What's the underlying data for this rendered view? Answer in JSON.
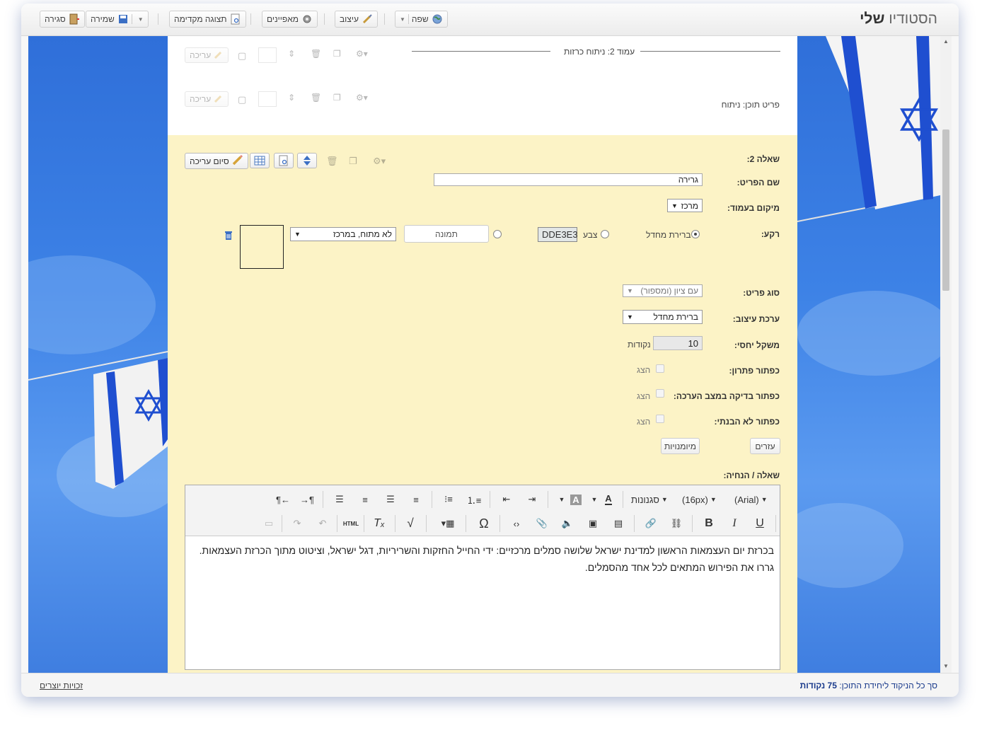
{
  "app": {
    "logo_main": "הסטודיו",
    "logo_bold": "שלי"
  },
  "toolbar": {
    "language": "שפה",
    "design": "עיצוב",
    "properties": "מאפיינים",
    "preview": "תצוגה מקדימה",
    "save": "שמירה",
    "close": "סגירה"
  },
  "page_header": "עמוד 2: ניתוח כרזות",
  "content_item": "פריט תוכן: ניתוח",
  "edit_label": "עריכה",
  "finish_edit": "סיום עריכה",
  "question": {
    "label": "שאלה 2:",
    "item_name_label": "שם הפריט:",
    "item_name_value": "גרירה",
    "position_label": "מיקום בעמוד:",
    "position_value": "מרכז",
    "background_label": "רקע:",
    "bg_default": "ברירת מחדל",
    "bg_color": "צבע",
    "bg_color_value": "DDE3E3",
    "bg_image_button": "תמונה",
    "bg_stretch_value": "לא מתוח, במרכז",
    "item_type_label": "סוג פריט:",
    "item_type_value": "עם ציון (ומספור)",
    "design_set_label": "ערכת עיצוב:",
    "design_set_value": "ברירת מחדל",
    "weight_label": "משקל יחסי:",
    "weight_value": "10",
    "weight_unit": "נקודות",
    "solution_btn_label": "כפתור פתרון:",
    "check_btn_label": "כפתור בדיקה במצב הערכה:",
    "not_understood_label": "כפתור לא הבנתי:",
    "show": "הצג",
    "helpers": "עזרים",
    "skills": "מיומנויות",
    "question_label": "שאלה / הנחיה:"
  },
  "editor": {
    "styles": "סגנונות",
    "font_size": "(16px)",
    "font_family": "(Arial)",
    "html_label": "HTML",
    "line1": "בכרזת יום העצמאות הראשון למדינת ישראל שלושה סמלים מרכזיים: ידי החייל החזקות והשריריות, דגל ישראל, וציטוט  מתוך הכרזת העצמאות.",
    "line2": "גררו את הפירוש המתאים לכל אחד מהסמלים."
  },
  "footer": {
    "total_prefix": "סך כל הניקוד ליחידת התוכן:",
    "total_value": "75 נקודות",
    "copyright": "זכויות יוצרים"
  },
  "colors": {
    "yellow_panel": "#fcf3c6",
    "sky": "#3d82e6",
    "flag_blue": "#1f4fd0",
    "link": "#1a3b8c"
  }
}
